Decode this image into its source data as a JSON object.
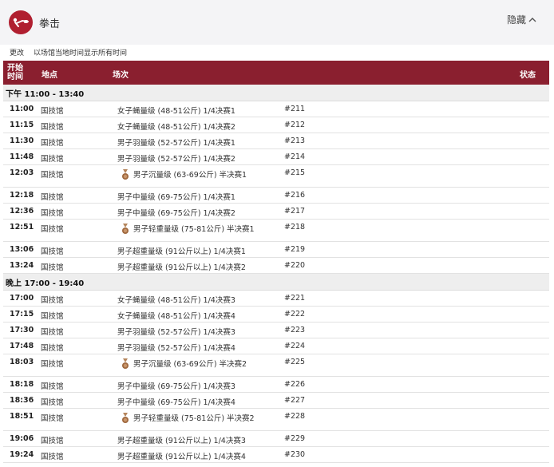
{
  "header": {
    "sport": "拳击",
    "hide_label": "隐藏"
  },
  "subbar": {
    "change": "更改",
    "local_time": "以场馆当地时间显示所有时间"
  },
  "columns": {
    "time": "开始时间",
    "venue": "地点",
    "event": "场次",
    "status": "状态"
  },
  "sessions": [
    {
      "label": "下午  11:00 - 13:40",
      "rows": [
        {
          "time": "11:00",
          "venue": "国技馆",
          "event": "女子蝇量级 (48-51公斤) 1/4决赛1",
          "num": "#211",
          "medal": false
        },
        {
          "time": "11:15",
          "venue": "国技馆",
          "event": "女子蝇量级 (48-51公斤) 1/4决赛2",
          "num": "#212",
          "medal": false
        },
        {
          "time": "11:30",
          "venue": "国技馆",
          "event": "男子羽量级 (52-57公斤) 1/4决赛1",
          "num": "#213",
          "medal": false
        },
        {
          "time": "11:48",
          "venue": "国技馆",
          "event": "男子羽量级 (52-57公斤) 1/4决赛2",
          "num": "#214",
          "medal": false
        },
        {
          "time": "12:03",
          "venue": "国技馆",
          "event": "男子沉量级 (63-69公斤) 半决赛1",
          "num": "#215",
          "medal": true
        },
        {
          "time": "12:18",
          "venue": "国技馆",
          "event": "男子中量级 (69-75公斤) 1/4决赛1",
          "num": "#216",
          "medal": false
        },
        {
          "time": "12:36",
          "venue": "国技馆",
          "event": "男子中量级 (69-75公斤) 1/4决赛2",
          "num": "#217",
          "medal": false
        },
        {
          "time": "12:51",
          "venue": "国技馆",
          "event": "男子轻重量级 (75-81公斤) 半决赛1",
          "num": "#218",
          "medal": true
        },
        {
          "time": "13:06",
          "venue": "国技馆",
          "event": "男子超重量级 (91公斤以上) 1/4决赛1",
          "num": "#219",
          "medal": false
        },
        {
          "time": "13:24",
          "venue": "国技馆",
          "event": "男子超重量级 (91公斤以上) 1/4决赛2",
          "num": "#220",
          "medal": false
        }
      ]
    },
    {
      "label": "晚上  17:00 - 19:40",
      "rows": [
        {
          "time": "17:00",
          "venue": "国技馆",
          "event": "女子蝇量级 (48-51公斤) 1/4决赛3",
          "num": "#221",
          "medal": false
        },
        {
          "time": "17:15",
          "venue": "国技馆",
          "event": "女子蝇量级 (48-51公斤) 1/4决赛4",
          "num": "#222",
          "medal": false
        },
        {
          "time": "17:30",
          "venue": "国技馆",
          "event": "男子羽量级 (52-57公斤) 1/4决赛3",
          "num": "#223",
          "medal": false
        },
        {
          "time": "17:48",
          "venue": "国技馆",
          "event": "男子羽量级 (52-57公斤) 1/4决赛4",
          "num": "#224",
          "medal": false
        },
        {
          "time": "18:03",
          "venue": "国技馆",
          "event": "男子沉量级 (63-69公斤) 半决赛2",
          "num": "#225",
          "medal": true
        },
        {
          "time": "18:18",
          "venue": "国技馆",
          "event": "男子中量级 (69-75公斤) 1/4决赛3",
          "num": "#226",
          "medal": false
        },
        {
          "time": "18:36",
          "venue": "国技馆",
          "event": "男子中量级 (69-75公斤) 1/4决赛4",
          "num": "#227",
          "medal": false
        },
        {
          "time": "18:51",
          "venue": "国技馆",
          "event": "男子轻重量级 (75-81公斤) 半决赛2",
          "num": "#228",
          "medal": true
        },
        {
          "time": "19:06",
          "venue": "国技馆",
          "event": "男子超重量级 (91公斤以上) 1/4决赛3",
          "num": "#229",
          "medal": false
        },
        {
          "time": "19:24",
          "venue": "国技馆",
          "event": "男子超重量级 (91公斤以上) 1/4决赛4",
          "num": "#230",
          "medal": false
        }
      ]
    }
  ],
  "icons": {
    "sport": "boxing-pictogram-icon",
    "toggle": "chevron-up-icon",
    "medal": "medal-icon"
  },
  "colors": {
    "brand": "#8a1f2f",
    "logo": "#b01f30",
    "medal": "#a0693f"
  }
}
